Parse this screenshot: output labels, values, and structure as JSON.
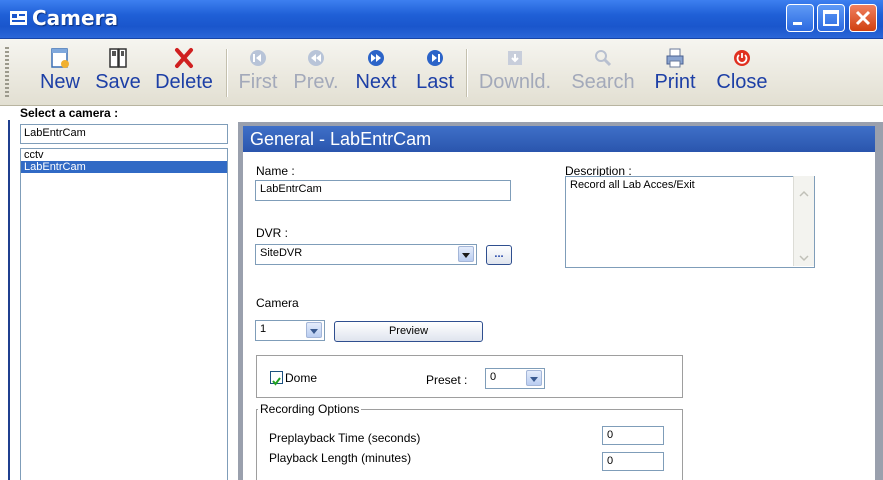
{
  "window": {
    "title": "Camera"
  },
  "toolbar": {
    "new": "New",
    "save": "Save",
    "delete": "Delete",
    "first": "First",
    "prev": "Prev.",
    "next": "Next",
    "last": "Last",
    "download": "Downld.",
    "search": "Search",
    "print": "Print",
    "close": "Close"
  },
  "sidebar": {
    "select_label": "Select a camera :",
    "input_value": "LabEntrCam",
    "items": [
      {
        "label": "cctv",
        "selected": false
      },
      {
        "label": "LabEntrCam",
        "selected": true
      }
    ]
  },
  "general": {
    "header": "General - LabEntrCam",
    "name_label": "Name :",
    "name_value": "LabEntrCam",
    "description_label": "Description :",
    "description_value": "Record all Lab Acces/Exit",
    "dvr_label": "DVR :",
    "dvr_value": "SiteDVR",
    "browse_label": "...",
    "camera_label": "Camera",
    "camera_value": "1",
    "preview_label": "Preview",
    "dome_label": "Dome",
    "dome_checked": true,
    "preset_label": "Preset :",
    "preset_value": "0",
    "recording_options_label": "Recording Options",
    "preplayback_label": "Preplayback Time (seconds)",
    "preplayback_value": "0",
    "playback_length_label": "Playback Length (minutes)",
    "playback_length_value": "0"
  },
  "colors": {
    "title_bar": "#1f5fd6",
    "toolbar_label": "#1d3fa6",
    "selection": "#316ac5",
    "header": "#2a55ad"
  }
}
